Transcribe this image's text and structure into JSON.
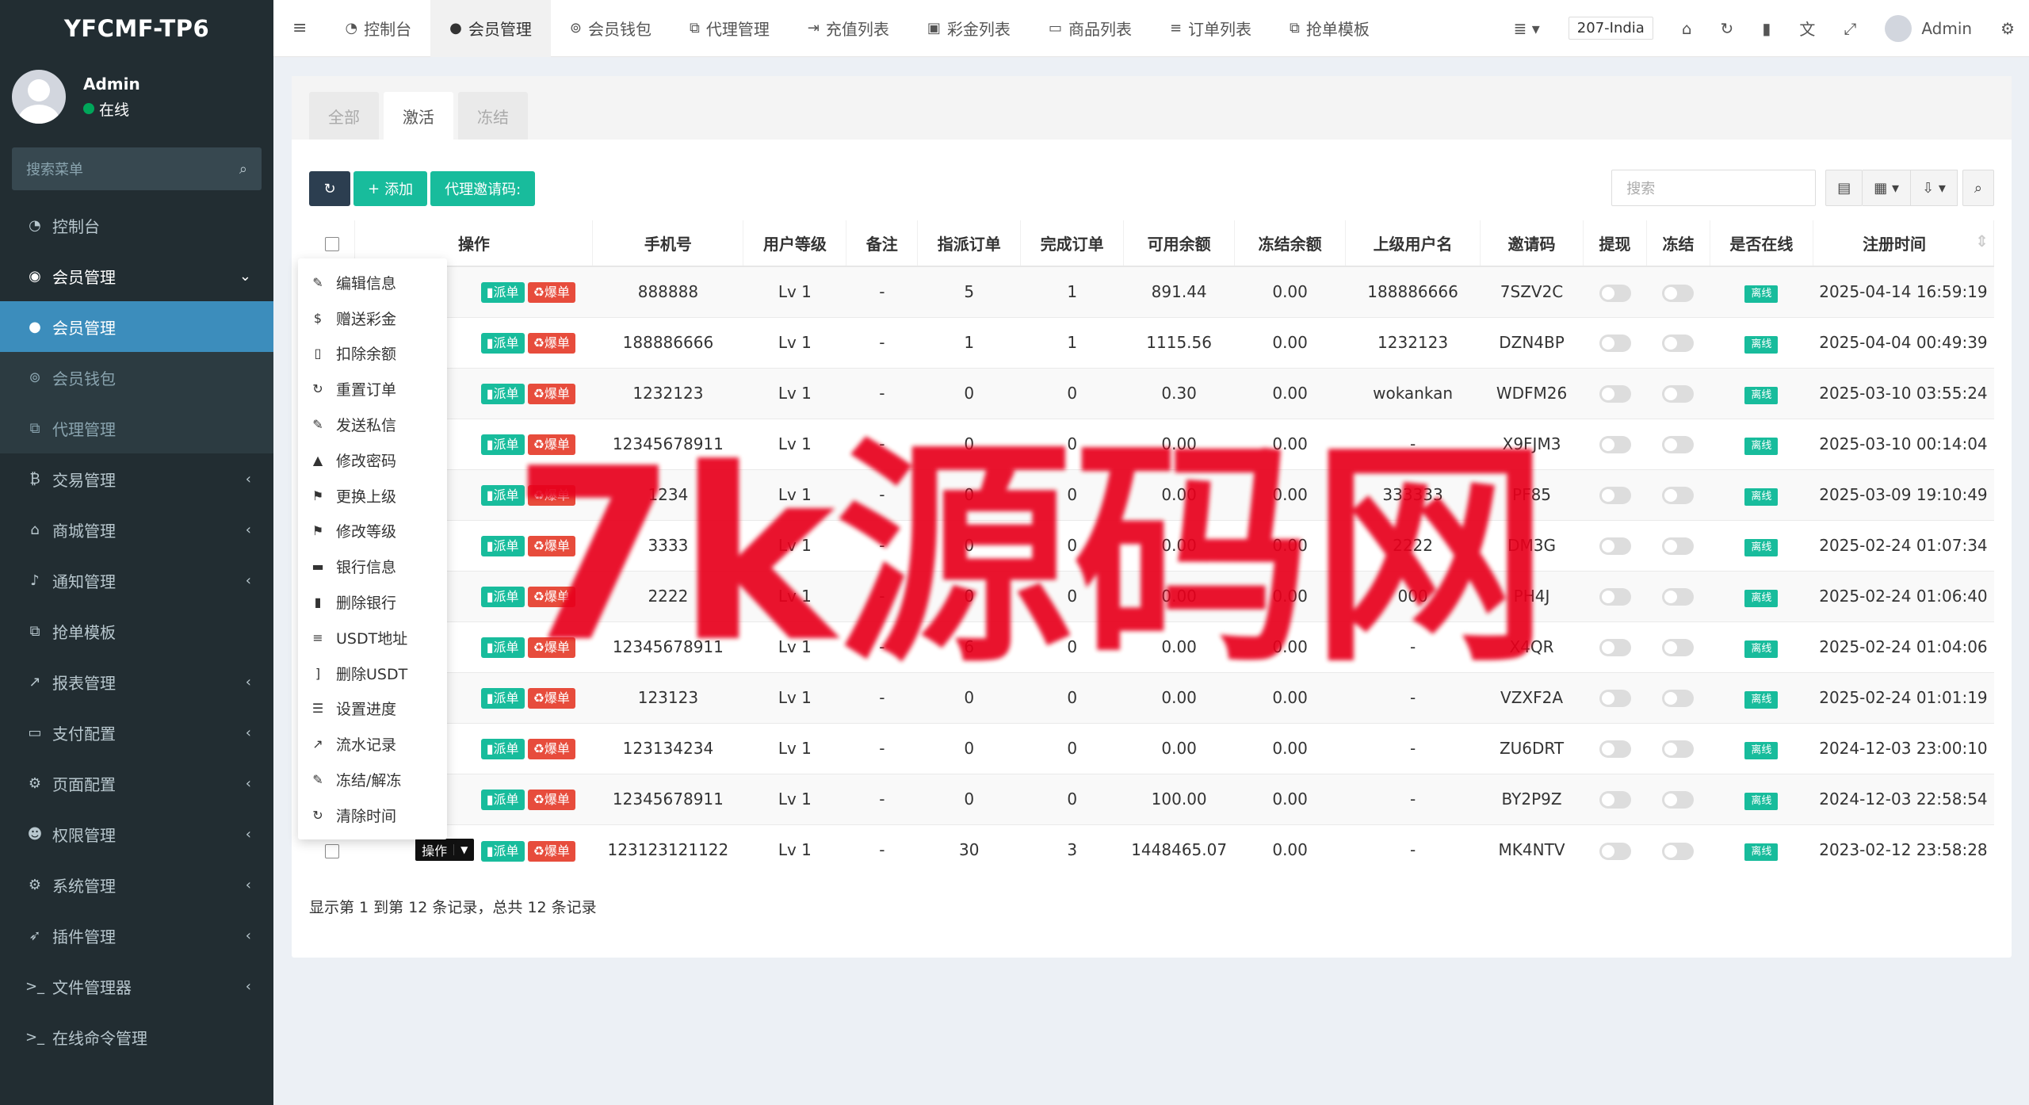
{
  "brand": "YFCMF-TP6",
  "user": {
    "name": "Admin",
    "status": "在线"
  },
  "sidebar": {
    "search_placeholder": "搜索菜单",
    "items": [
      {
        "label": "控制台",
        "icon": "dashboard-icon",
        "glyph": "◔",
        "state": "",
        "arrow": ""
      },
      {
        "label": "会员管理",
        "icon": "user-circle-icon",
        "glyph": "◉",
        "state": "open",
        "arrow": "⌄"
      },
      {
        "label": "会员管理",
        "icon": "user-icon",
        "glyph": "●",
        "state": "active",
        "arrow": ""
      },
      {
        "label": "会员钱包",
        "icon": "wallet-icon",
        "glyph": "⊚",
        "state": "dim",
        "arrow": ""
      },
      {
        "label": "代理管理",
        "icon": "sitemap-icon",
        "glyph": "⧉",
        "state": "dim",
        "arrow": ""
      },
      {
        "label": "交易管理",
        "icon": "bitcoin-icon",
        "glyph": "₿",
        "state": "",
        "arrow": "‹"
      },
      {
        "label": "商城管理",
        "icon": "home-icon",
        "glyph": "⌂",
        "state": "",
        "arrow": "‹"
      },
      {
        "label": "通知管理",
        "icon": "bell-icon",
        "glyph": "♪",
        "state": "",
        "arrow": "‹"
      },
      {
        "label": "抢单模板",
        "icon": "sitemap-icon",
        "glyph": "⧉",
        "state": "",
        "arrow": ""
      },
      {
        "label": "报表管理",
        "icon": "chart-icon",
        "glyph": "↗",
        "state": "",
        "arrow": "‹"
      },
      {
        "label": "支付配置",
        "icon": "credit-card-icon",
        "glyph": "▭",
        "state": "",
        "arrow": "‹"
      },
      {
        "label": "页面配置",
        "icon": "gear-icon",
        "glyph": "⚙",
        "state": "",
        "arrow": "‹"
      },
      {
        "label": "权限管理",
        "icon": "users-icon",
        "glyph": "☻",
        "state": "",
        "arrow": "‹"
      },
      {
        "label": "系统管理",
        "icon": "gears-icon",
        "glyph": "⚙",
        "state": "",
        "arrow": "‹"
      },
      {
        "label": "插件管理",
        "icon": "rocket-icon",
        "glyph": "➶",
        "state": "",
        "arrow": "‹"
      },
      {
        "label": "文件管理器",
        "icon": "terminal-icon",
        "glyph": ">_",
        "state": "",
        "arrow": "‹"
      },
      {
        "label": "在线命令管理",
        "icon": "terminal-icon",
        "glyph": ">_",
        "state": "",
        "arrow": ""
      }
    ]
  },
  "topbar": {
    "tabs": [
      {
        "label": "控制台",
        "icon": "dashboard-icon",
        "glyph": "◔"
      },
      {
        "label": "会员管理",
        "icon": "user-icon",
        "glyph": "●",
        "active": true
      },
      {
        "label": "会员钱包",
        "icon": "wallet-icon",
        "glyph": "⊚"
      },
      {
        "label": "代理管理",
        "icon": "sitemap-icon",
        "glyph": "⧉"
      },
      {
        "label": "充值列表",
        "icon": "sign-in-icon",
        "glyph": "⇥"
      },
      {
        "label": "彩金列表",
        "icon": "gift-icon",
        "glyph": "▣"
      },
      {
        "label": "商品列表",
        "icon": "monitor-icon",
        "glyph": "▭"
      },
      {
        "label": "订单列表",
        "icon": "list-icon",
        "glyph": "≡"
      },
      {
        "label": "抢单模板",
        "icon": "sitemap-icon",
        "glyph": "⧉"
      }
    ],
    "country": "207-India",
    "admin": "Admin"
  },
  "content": {
    "tabs": [
      "全部",
      "激活",
      "冻结"
    ],
    "active_tab": 1,
    "toolbar": {
      "add": "添加",
      "invite": "代理邀请码:"
    },
    "search_placeholder": "搜索",
    "columns": [
      "操作",
      "手机号",
      "用户等级",
      "备注",
      "指派订单",
      "完成订单",
      "可用余额",
      "冻结余额",
      "上级用户名",
      "邀请码",
      "提现",
      "冻结",
      "是否在线",
      "注册时间"
    ],
    "tag_dispatch": "派单",
    "tag_burst": "爆单",
    "online_label": "离线",
    "op_label": "操作",
    "rows": [
      {
        "phone": "888888",
        "level": "Lv 1",
        "note": "-",
        "assigned": "5",
        "done": "1",
        "balance": "891.44",
        "frozen": "0.00",
        "parent": "188886666",
        "code": "7SZV2C",
        "time": "2025-04-14 16:59:19"
      },
      {
        "phone": "188886666",
        "level": "Lv 1",
        "note": "-",
        "assigned": "1",
        "done": "1",
        "balance": "1115.56",
        "frozen": "0.00",
        "parent": "1232123",
        "code": "DZN4BP",
        "time": "2025-04-04 00:49:39"
      },
      {
        "phone": "1232123",
        "level": "Lv 1",
        "note": "-",
        "assigned": "0",
        "done": "0",
        "balance": "0.30",
        "frozen": "0.00",
        "parent": "wokankan",
        "code": "WDFM26",
        "time": "2025-03-10 03:55:24"
      },
      {
        "phone": "12345678911",
        "level": "Lv 1",
        "note": "-",
        "assigned": "0",
        "done": "0",
        "balance": "0.00",
        "frozen": "0.00",
        "parent": "-",
        "code": "X9FJM3",
        "time": "2025-03-10 00:14:04"
      },
      {
        "phone": "1234",
        "level": "Lv 1",
        "note": "-",
        "assigned": "0",
        "done": "0",
        "balance": "0.00",
        "frozen": "0.00",
        "parent": "333333",
        "code": "PF85",
        "time": "2025-03-09 19:10:49"
      },
      {
        "phone": "3333",
        "level": "Lv 1",
        "note": "-",
        "assigned": "0",
        "done": "0",
        "balance": "0.00",
        "frozen": "0.00",
        "parent": "2222",
        "code": "DM3G",
        "time": "2025-02-24 01:07:34"
      },
      {
        "phone": "2222",
        "level": "Lv 1",
        "note": "-",
        "assigned": "0",
        "done": "0",
        "balance": "0.00",
        "frozen": "0.00",
        "parent": "000",
        "code": "PH4J",
        "time": "2025-02-24 01:06:40"
      },
      {
        "phone": "12345678911",
        "level": "Lv 1",
        "note": "-",
        "assigned": "6",
        "done": "0",
        "balance": "0.00",
        "frozen": "0.00",
        "parent": "-",
        "code": "X4QR",
        "time": "2025-02-24 01:04:06"
      },
      {
        "phone": "123123",
        "level": "Lv 1",
        "note": "-",
        "assigned": "0",
        "done": "0",
        "balance": "0.00",
        "frozen": "0.00",
        "parent": "-",
        "code": "VZXF2A",
        "time": "2025-02-24 01:01:19"
      },
      {
        "phone": "123134234",
        "level": "Lv 1",
        "note": "-",
        "assigned": "0",
        "done": "0",
        "balance": "0.00",
        "frozen": "0.00",
        "parent": "-",
        "code": "ZU6DRT",
        "time": "2024-12-03 23:00:10"
      },
      {
        "phone": "12345678911",
        "level": "Lv 1",
        "note": "-",
        "assigned": "0",
        "done": "0",
        "balance": "100.00",
        "frozen": "0.00",
        "parent": "-",
        "code": "BY2P9Z",
        "time": "2024-12-03 22:58:54"
      },
      {
        "phone": "123123121122",
        "level": "Lv 1",
        "note": "-",
        "assigned": "30",
        "done": "3",
        "balance": "1448465.07",
        "frozen": "0.00",
        "parent": "-",
        "code": "MK4NTV",
        "time": "2023-02-12 23:58:28"
      }
    ],
    "pager": "显示第 1 到第 12 条记录，总共 12 条记录"
  },
  "dropdown": [
    {
      "label": "编辑信息",
      "icon": "pencil-icon",
      "glyph": "✎"
    },
    {
      "label": "赠送彩金",
      "icon": "dollar-icon",
      "glyph": "$"
    },
    {
      "label": "扣除余额",
      "icon": "shield-icon",
      "glyph": "▯"
    },
    {
      "label": "重置订单",
      "icon": "recycle-icon",
      "glyph": "↻"
    },
    {
      "label": "发送私信",
      "icon": "pencil-icon",
      "glyph": "✎"
    },
    {
      "label": "修改密码",
      "icon": "lock-icon",
      "glyph": "▲"
    },
    {
      "label": "更换上级",
      "icon": "flag-icon",
      "glyph": "⚑"
    },
    {
      "label": "修改等级",
      "icon": "flag-icon",
      "glyph": "⚑"
    },
    {
      "label": "银行信息",
      "icon": "credit-card-icon",
      "glyph": "▬"
    },
    {
      "label": "删除银行",
      "icon": "trash-icon",
      "glyph": "▮"
    },
    {
      "label": "USDT地址",
      "icon": "align-icon",
      "glyph": "≡"
    },
    {
      "label": "删除USDT",
      "icon": "bracket-icon",
      "glyph": "]"
    },
    {
      "label": "设置进度",
      "icon": "sliders-icon",
      "glyph": "☰"
    },
    {
      "label": "流水记录",
      "icon": "line-chart-icon",
      "glyph": "↗"
    },
    {
      "label": "冻结/解冻",
      "icon": "pencil-icon",
      "glyph": "✎"
    },
    {
      "label": "清除时间",
      "icon": "recycle-icon",
      "glyph": "↻"
    }
  ],
  "watermark": "7k源码网",
  "colors": {
    "sidebar_bg": "#222d32",
    "active": "#3c8dbc",
    "green": "#18bc9c",
    "red": "#e74c3c",
    "watermark": "#e8001c"
  }
}
